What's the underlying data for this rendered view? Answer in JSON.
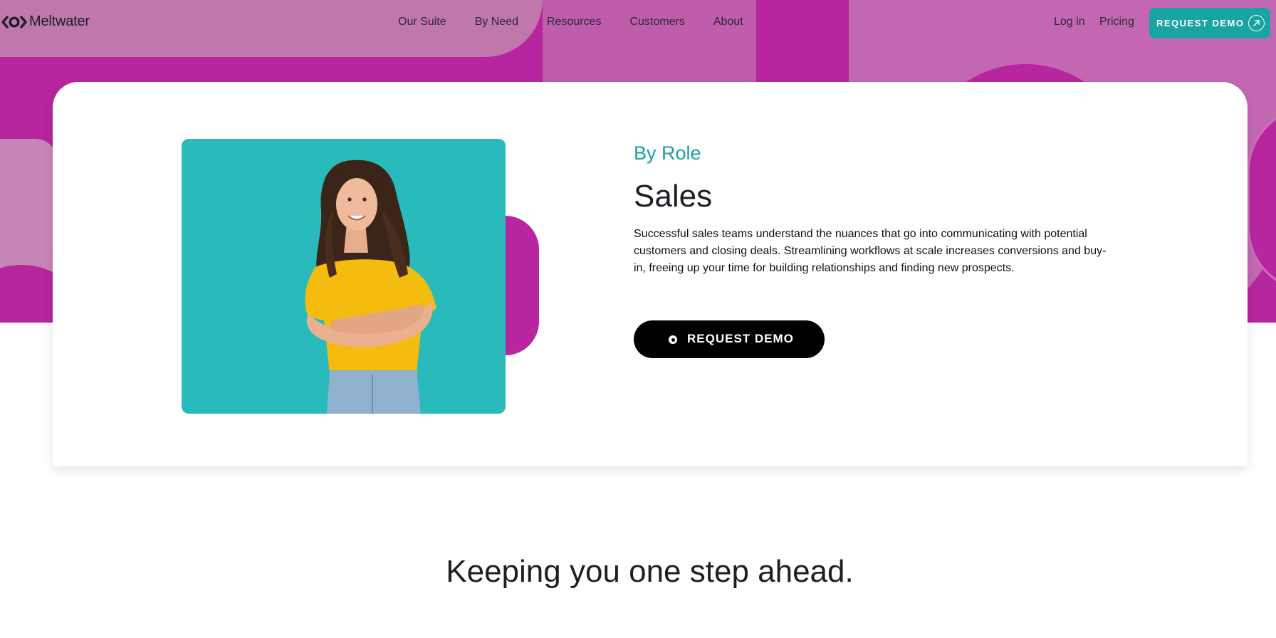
{
  "brand": {
    "name": "Meltwater"
  },
  "nav": {
    "links": [
      "Our Suite",
      "By Need",
      "Resources",
      "Customers",
      "About"
    ],
    "login_label": "Log in",
    "pricing_label": "Pricing",
    "demo_label": "REQUEST DEMO"
  },
  "hero": {
    "eyebrow": "By Role",
    "title": "Sales",
    "description": "Successful sales teams understand the nuances that go into communicating with potential customers and closing deals. Streamlining workflows at scale increases conversions and buy-in, freeing up your time for building relationships and finding new prospects.",
    "cta_label": "REQUEST DEMO"
  },
  "section": {
    "headline": "Keeping you one step ahead."
  },
  "colors": {
    "magenta": "#b7259f",
    "teal": "#19a4a3",
    "photo_bg": "#29bbbb",
    "text": "#1e1e24"
  },
  "icons": [
    "meltwater-logo-icon",
    "arrow-up-right-icon",
    "ring-dot-icon"
  ]
}
